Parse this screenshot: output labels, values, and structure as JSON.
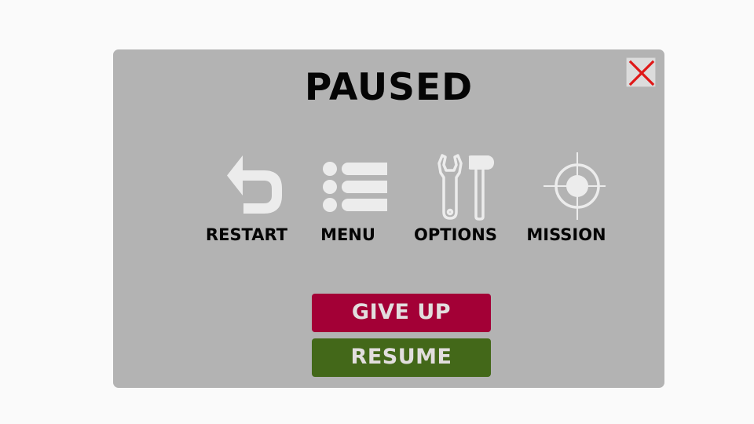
{
  "pause_menu": {
    "title": "PAUSED",
    "close_icon": "close-x-icon",
    "options": [
      {
        "label": "RESTART",
        "icon": "restart-arrow-icon"
      },
      {
        "label": "MENU",
        "icon": "list-menu-icon"
      },
      {
        "label": "OPTIONS",
        "icon": "wrench-hammer-icon"
      },
      {
        "label": "MISSION",
        "icon": "crosshair-icon"
      }
    ],
    "give_up_label": "GIVE UP",
    "resume_label": "RESUME"
  },
  "colors": {
    "panel": "#b3b3b3",
    "icon": "#ececec",
    "give_up": "#a30036",
    "resume": "#436819",
    "close_x": "#e01818"
  }
}
